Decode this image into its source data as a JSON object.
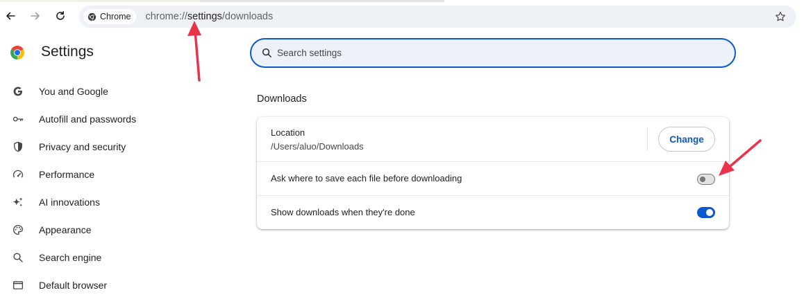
{
  "toolbar": {
    "chip_label": "Chrome",
    "url_scheme": "chrome://",
    "url_host": "settings",
    "url_path": "/downloads",
    "icons": [
      "back-arrow-icon",
      "forward-arrow-icon",
      "reload-icon",
      "chrome-icon",
      "star-icon"
    ]
  },
  "header": {
    "title": "Settings",
    "search_placeholder": "Search settings"
  },
  "sidebar": {
    "items": [
      {
        "label": "You and Google",
        "icon": "google-g-icon"
      },
      {
        "label": "Autofill and passwords",
        "icon": "key-icon"
      },
      {
        "label": "Privacy and security",
        "icon": "shield-icon"
      },
      {
        "label": "Performance",
        "icon": "speedometer-icon"
      },
      {
        "label": "AI innovations",
        "icon": "sparkle-icon"
      },
      {
        "label": "Appearance",
        "icon": "palette-icon"
      },
      {
        "label": "Search engine",
        "icon": "search-icon"
      },
      {
        "label": "Default browser",
        "icon": "browser-window-icon"
      }
    ]
  },
  "downloads": {
    "section_title": "Downloads",
    "location_label": "Location",
    "location_path": "/Users/aluo/Downloads",
    "change_button": "Change",
    "ask_label": "Ask where to save each file before downloading",
    "ask_enabled": false,
    "show_label": "Show downloads when they're done",
    "show_enabled": true
  },
  "colors": {
    "accent": "#0b57d0",
    "search_bg": "#edf2fa",
    "annotation_arrow": "#e8334a"
  }
}
